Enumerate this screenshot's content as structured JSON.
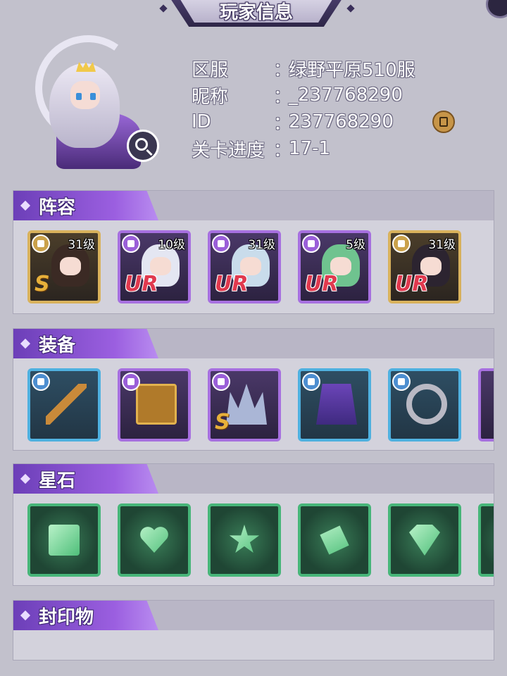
{
  "header": {
    "title": "玩家信息"
  },
  "player": {
    "fields": [
      {
        "label": "区服",
        "colon": "：",
        "value": "绿野平原510服"
      },
      {
        "label": "昵称",
        "colon": "：",
        "value": "_237768290"
      },
      {
        "label": "ID",
        "colon": "：",
        "value": "237768290"
      },
      {
        "label": "关卡进度",
        "colon": "：",
        "value": "17-1"
      }
    ]
  },
  "sections": {
    "lineup": {
      "title": "阵容",
      "heroes": [
        {
          "level": "31级",
          "rarity": "S",
          "frame": "gold"
        },
        {
          "level": "10级",
          "rarity": "UR",
          "frame": "purple"
        },
        {
          "level": "31级",
          "rarity": "UR",
          "frame": "purple"
        },
        {
          "level": "5级",
          "rarity": "UR",
          "frame": "purple"
        },
        {
          "level": "31级",
          "rarity": "UR",
          "frame": "gold"
        }
      ]
    },
    "equipment": {
      "title": "装备",
      "items": [
        {
          "icon": "scepter-icon",
          "frame": "blue"
        },
        {
          "icon": "book-icon",
          "frame": "purple"
        },
        {
          "icon": "crown-icon",
          "frame": "purple",
          "rarity": "S"
        },
        {
          "icon": "cloak-icon",
          "frame": "blue"
        },
        {
          "icon": "ring-icon",
          "frame": "blue"
        }
      ]
    },
    "star_stones": {
      "title": "星石",
      "items": [
        {
          "icon": "square-gem-icon"
        },
        {
          "icon": "heart-gem-icon"
        },
        {
          "icon": "star-gem-icon"
        },
        {
          "icon": "diamond-gem-icon"
        },
        {
          "icon": "triangle-gem-icon"
        }
      ]
    },
    "seals": {
      "title": "封印物"
    }
  },
  "colors": {
    "accent": "#9b5fe0",
    "gold": "#d9b25c",
    "ur": "#e0394e",
    "gem": "#4fbf7a"
  }
}
